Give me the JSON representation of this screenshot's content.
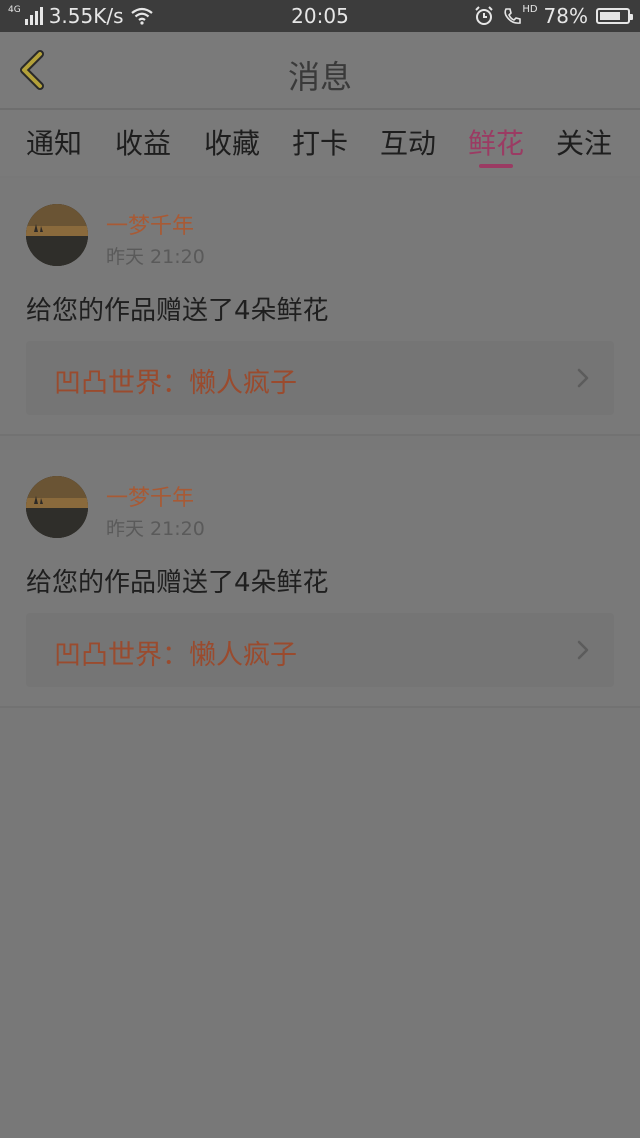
{
  "status_bar": {
    "network_type": "4G",
    "speed": "3.55K/s",
    "time": "20:05",
    "hd_label": "HD",
    "battery_percent": "78%",
    "battery_level": 0.78,
    "icons": [
      "signal-icon",
      "wifi-icon",
      "alarm-icon",
      "call-hd-icon",
      "battery-icon"
    ]
  },
  "header": {
    "title": "消息",
    "back_icon": "chevron-left-icon"
  },
  "tabs": {
    "items": [
      {
        "label": "通知"
      },
      {
        "label": "收益"
      },
      {
        "label": "收藏"
      },
      {
        "label": "打卡"
      },
      {
        "label": "互动"
      },
      {
        "label": "鲜花"
      },
      {
        "label": "关注"
      }
    ],
    "active_index": 5
  },
  "notifications": [
    {
      "user": "一梦千年",
      "time": "昨天 21:20",
      "message": "给您的作品赠送了4朵鲜花",
      "link_text": "凹凸世界：懒人疯子"
    },
    {
      "user": "一梦千年",
      "time": "昨天 21:20",
      "message": "给您的作品赠送了4朵鲜花",
      "link_text": "凹凸世界：懒人疯子"
    }
  ],
  "colors": {
    "accent": "#9b3b63",
    "username": "#a85a35",
    "link": "#9a4b2e",
    "overlay_bg": "#787878"
  }
}
